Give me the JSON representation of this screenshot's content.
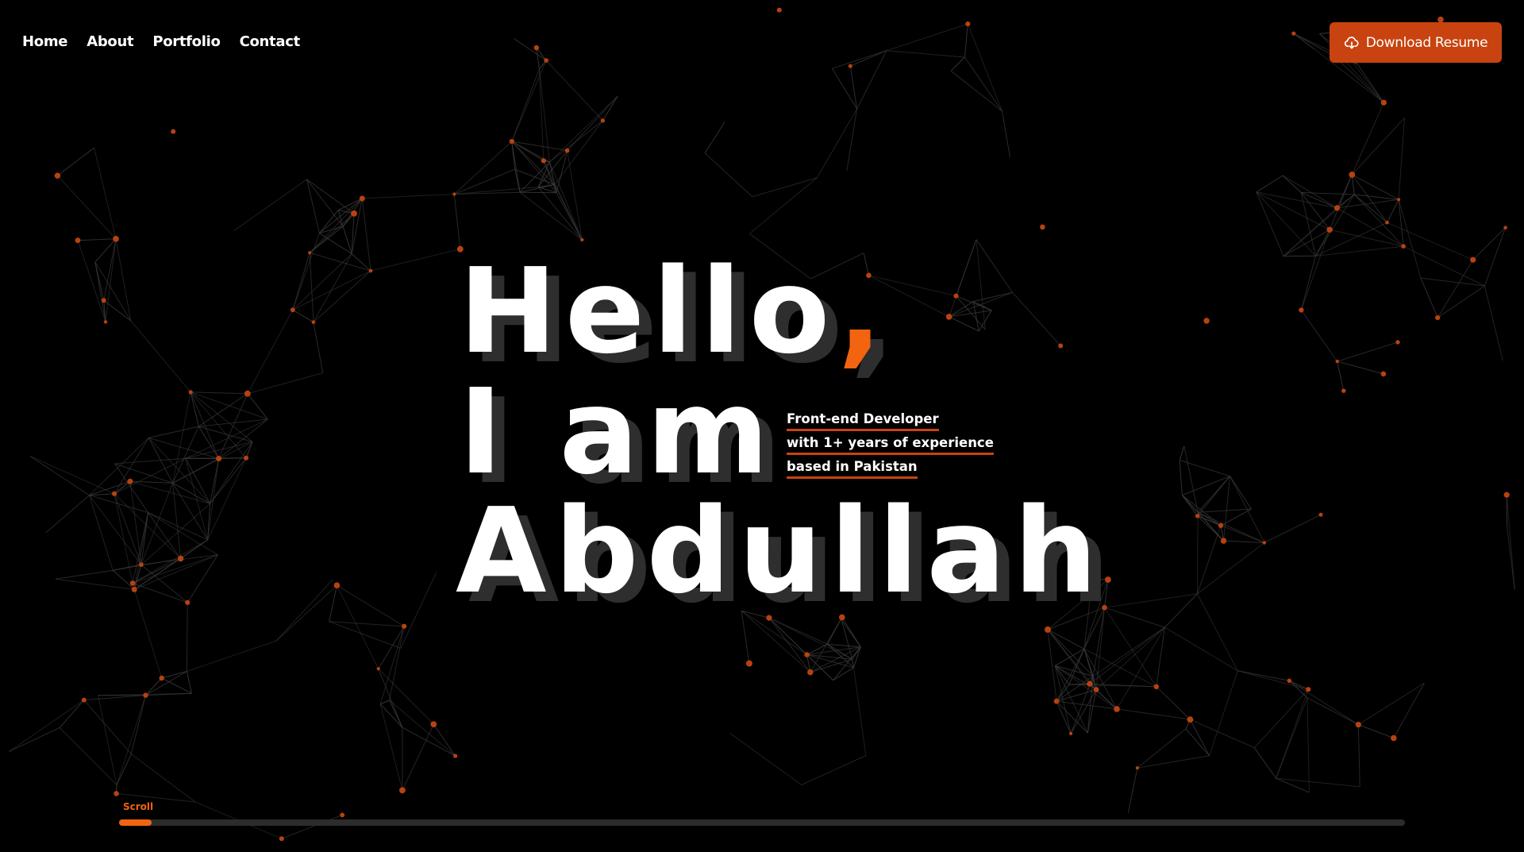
{
  "nav": {
    "items": [
      {
        "label": "Home"
      },
      {
        "label": "About"
      },
      {
        "label": "Portfolio"
      },
      {
        "label": "Contact"
      }
    ]
  },
  "resume_button": {
    "label": "Download Resume",
    "icon": "cloud-download-icon"
  },
  "hero": {
    "line1": "Hello",
    "comma": ",",
    "line2": "I am",
    "line3": "Abdullah"
  },
  "tagline": {
    "lines": [
      "Front-end Developer",
      "with 1+ years of experience",
      "based in Pakistan"
    ]
  },
  "scroll": {
    "label": "Scroll",
    "progress": 0.025
  },
  "colors": {
    "background": "#000000",
    "accent": "#f2640f",
    "button": "#c8430f",
    "text": "#ffffff",
    "text_shadow": "#2e2e2e",
    "network_line": "#3a3a3a",
    "network_node": "#b8420f"
  }
}
